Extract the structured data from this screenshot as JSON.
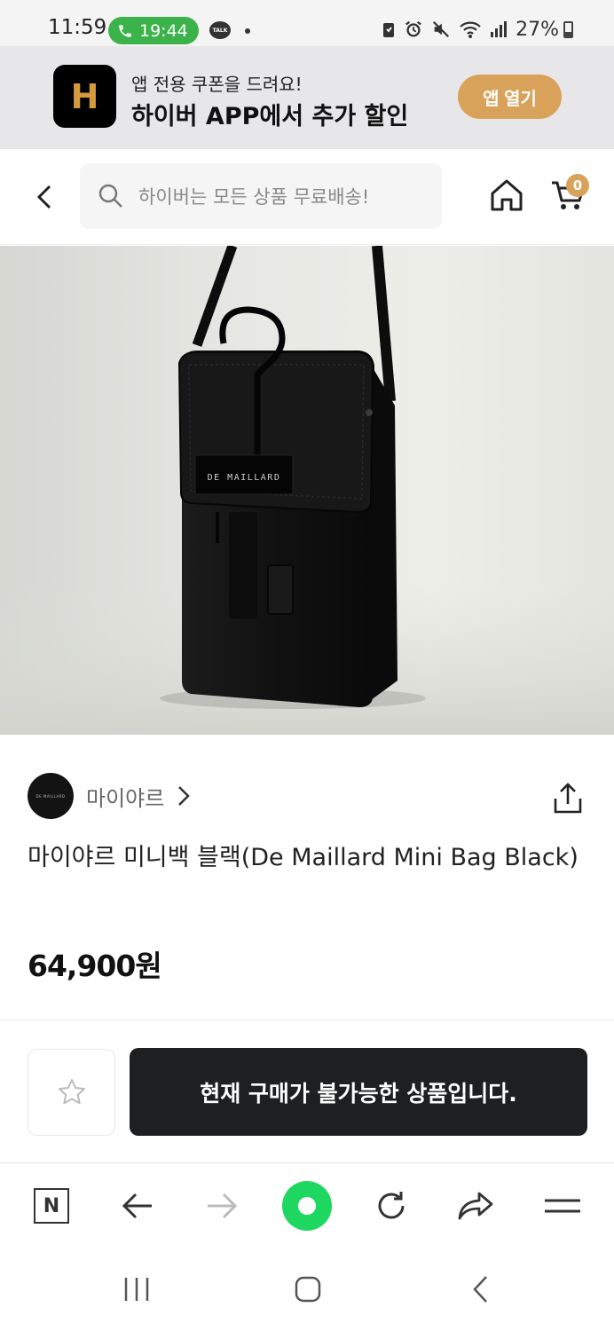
{
  "status_bar": {
    "time": "11:59",
    "call_time": "19:44",
    "talk_badge": "TALK",
    "battery": "27%"
  },
  "app_banner": {
    "logo_letter": "H",
    "subtitle": "앱 전용 쿠폰을 드려요!",
    "title": "하이버 APP에서 추가 할인",
    "open_label": "앱 열기"
  },
  "header": {
    "search_placeholder": "하이버는 모든 상품 무료배송!",
    "cart_count": "0"
  },
  "product": {
    "image_label": "DE MAILLARD",
    "brand_avatar_text": "DE MAILLARD",
    "brand_name": "마이야르",
    "title": "마이야르 미니백 블랙(De Maillard Mini Bag Black)",
    "price": "64,900원"
  },
  "purchase": {
    "status_label": "현재 구매가 불가능한 상품입니다."
  },
  "browser_toolbar": {
    "n_label": "N"
  },
  "colors": {
    "accent": "#d9a25a",
    "buy_button": "#1d1f21",
    "call_pill": "#3cb34a",
    "green_button": "#1ed760"
  }
}
